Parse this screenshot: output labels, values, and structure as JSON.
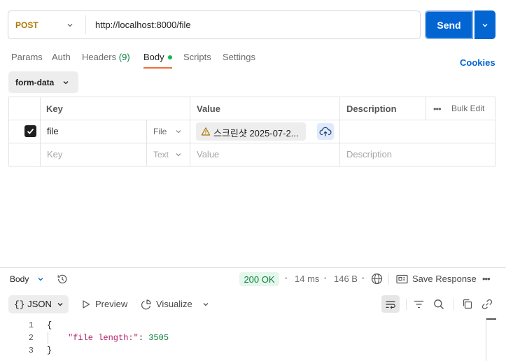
{
  "request": {
    "method": "POST",
    "url": "http://localhost:8000/file",
    "send_label": "Send"
  },
  "tabs": [
    {
      "label": "Params"
    },
    {
      "label": "Auth"
    },
    {
      "label": "Headers",
      "count": "(9)"
    },
    {
      "label": "Body",
      "active": true
    },
    {
      "label": "Scripts"
    },
    {
      "label": "Settings"
    }
  ],
  "cookies_label": "Cookies",
  "body_mode": "form-data",
  "table": {
    "headers": {
      "key": "Key",
      "value": "Value",
      "description": "Description",
      "bulk_edit": "Bulk Edit",
      "more": "•••"
    },
    "rows": [
      {
        "checked": true,
        "key": "file",
        "type": "File",
        "value": "스크린샷 2025-07-2...",
        "description": ""
      }
    ],
    "placeholder": {
      "key": "Key",
      "type": "Text",
      "value": "Value",
      "description": "Description"
    }
  },
  "response": {
    "label": "Body",
    "status": "200 OK",
    "time": "14 ms",
    "size": "146 B",
    "save_label": "Save Response",
    "more": "•••",
    "format_label": "JSON",
    "preview_label": "Preview",
    "visualize_label": "Visualize",
    "lines": [
      "1",
      "2",
      "3"
    ],
    "code": {
      "open": "{",
      "key": "\"file length:\"",
      "colon": ": ",
      "value": "3505",
      "close": "}"
    }
  },
  "colors": {
    "accent": "#0265d2",
    "tab_indicator": "#f26b3a",
    "status_ok": "#0a7f3f",
    "method": "#ad7a03"
  }
}
